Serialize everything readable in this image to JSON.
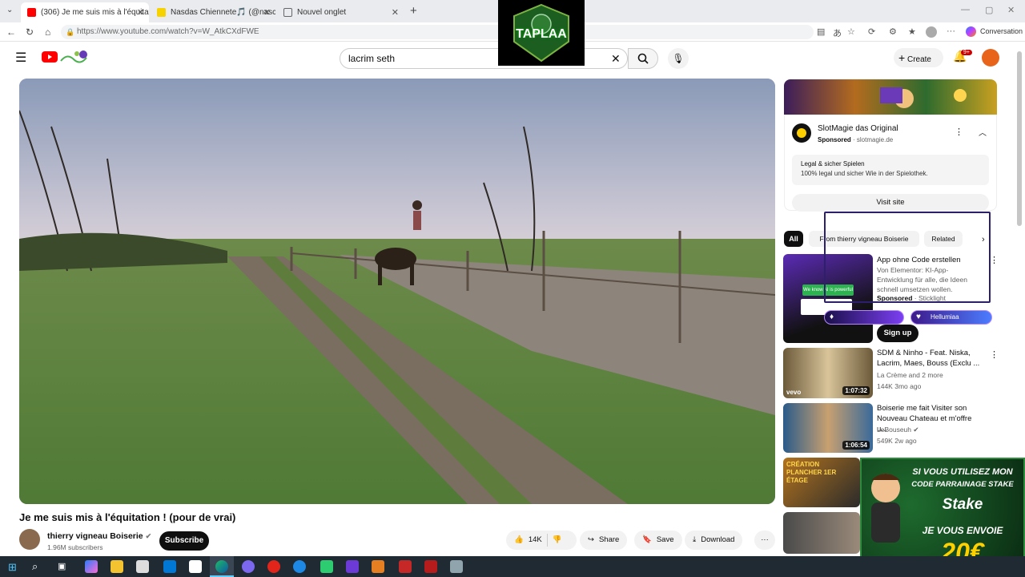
{
  "browser": {
    "tabs": [
      {
        "title": "(306) Je me suis mis à l'équitati",
        "favicon_color": "#ff0000",
        "active": true
      },
      {
        "title": "Nasdas Chiennete🎵 (@naschien",
        "favicon_color": "#f5d200",
        "active": false
      },
      {
        "title": "Nouvel onglet",
        "favicon_color": "#666666",
        "active": false
      }
    ],
    "url": "https://www.youtube.com/watch?v=W_AtkCXdFWE",
    "conversation_label": "Conversation"
  },
  "overlay_logo": {
    "text": "TAPLAA"
  },
  "youtube": {
    "search_value": "lacrim seth",
    "create_label": "Create",
    "notification_badge": "9+",
    "video": {
      "title": "Je me suis mis à l'équitation ! (pour de vrai)",
      "channel": "thierry vigneau Boiserie",
      "subscribers": "1.96M subscribers",
      "subscribe_label": "Subscribe",
      "likes": "14K",
      "share_label": "Share",
      "save_label": "Save",
      "download_label": "Download"
    },
    "ad": {
      "name": "SlotMagie das Original",
      "sponsored": "Sponsored",
      "domain": "slotmagie.de",
      "headline": "Legal & sicher Spielen",
      "description": "100% legal und sicher Wie in der Spielothek.",
      "visit_label": "Visit site"
    },
    "chips": [
      "All",
      "From thierry vigneau Boiserie",
      "Related"
    ],
    "recommended": [
      {
        "title": "App ohne Code erstellen",
        "desc": "Von Elementor: KI-App-Entwicklung für alle, die Ideen schnell umsetzen wollen.",
        "sponsored": "Sponsored",
        "source": "Sticklight",
        "thumb_text": "We know AI is powerful",
        "cta": "Sign up"
      },
      {
        "title": "SDM & Ninho - Feat. Niska, Lacrim, Maes, Bouss (Exclu ...",
        "channel": "La Crème and 2 more",
        "meta": "144K   3mo ago",
        "duration": "1:07:32"
      },
      {
        "title": "Boiserie me fait Visiter son Nouveau Chateau et m'offre u...",
        "channel": "LeBouseuh",
        "meta": "549K   2w ago",
        "duration": "1:06:54"
      },
      {
        "title": "",
        "thumb_text": "CRÉATION PLANCHER 1ER ÉTAGE"
      }
    ]
  },
  "overlay_badges": [
    "",
    "Hellumiaa"
  ],
  "overlay_ad": {
    "line1": "SI VOUS UTILISEZ MON",
    "line2": "CODE PARRAINAGE STAKE",
    "brand": "Stake",
    "line3": "JE VOUS ENVOIE",
    "amount": "20€"
  }
}
